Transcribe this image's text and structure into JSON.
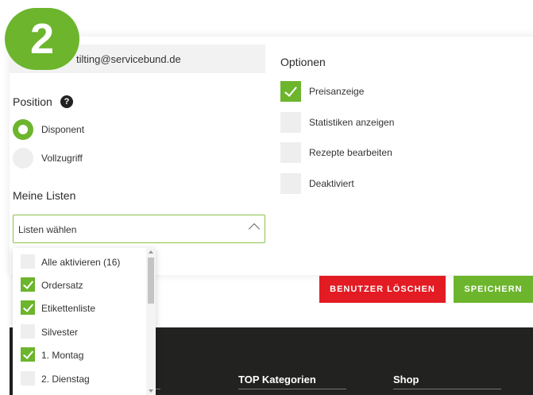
{
  "step": {
    "number": "2"
  },
  "account": {
    "email_value": "tilting@servicebund.de"
  },
  "position": {
    "heading": "Position",
    "help_glyph": "?",
    "options": [
      {
        "label": "Disponent",
        "selected": true
      },
      {
        "label": "Vollzugriff",
        "selected": false
      }
    ]
  },
  "lists": {
    "heading": "Meine Listen",
    "select_placeholder": "Listen wählen",
    "items": [
      {
        "label": "Alle aktivieren (16)",
        "checked": false
      },
      {
        "label": "Ordersatz",
        "checked": true
      },
      {
        "label": "Etikettenliste",
        "checked": true
      },
      {
        "label": "Silvester",
        "checked": false
      },
      {
        "label": "1. Montag",
        "checked": true
      },
      {
        "label": "2. Dienstag",
        "checked": false
      }
    ]
  },
  "options": {
    "heading": "Optionen",
    "items": [
      {
        "label": "Preisanzeige",
        "checked": true
      },
      {
        "label": "Statistiken anzeigen",
        "checked": false
      },
      {
        "label": "Rezepte bearbeiten",
        "checked": false
      },
      {
        "label": "Deaktiviert",
        "checked": false
      }
    ]
  },
  "actions": {
    "delete_label": "BENUTZER LÖSCHEN",
    "save_label": "SPEICHERN"
  },
  "footer": {
    "col1": "TOP Kategorien",
    "col2": "Shop"
  },
  "colors": {
    "accent": "#6cb52d",
    "danger": "#e31b23",
    "footer_bg": "#222220"
  }
}
